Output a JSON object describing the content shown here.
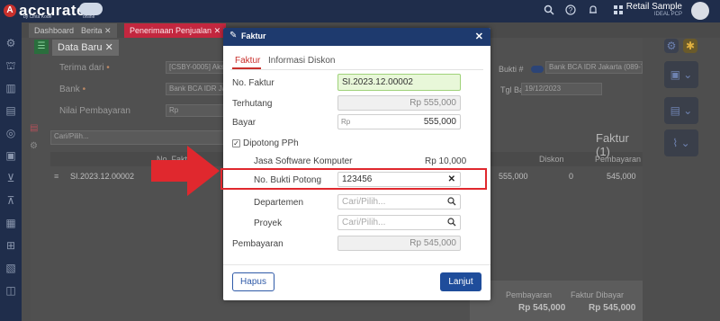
{
  "topbar": {
    "logo_text": "accurate",
    "logo_sub": "by Cinta Kode",
    "cloud_sub": "online",
    "user_name": "Retail Sample",
    "user_sub": "IDEAL PCP",
    "icons": [
      "search-icon",
      "help-icon",
      "bell-icon",
      "grid-icon"
    ]
  },
  "tabs": [
    {
      "label": "Dashboard",
      "active": false
    },
    {
      "label": "Berita",
      "active": false
    },
    {
      "label": "Penerimaan Penjualan",
      "active": true
    }
  ],
  "subtab": {
    "label": "Data Baru"
  },
  "form": {
    "terima_dari_label": "Terima dari",
    "terima_dari_value": "[CSBY-0005] Aks...",
    "bank_label": "Bank",
    "bank_value": "Bank BCA IDR Jak...",
    "nilai_label": "Nilai Pembayaran",
    "nilai_prefix": "Rp",
    "cari_placeholder": "Cari/Pilih...",
    "no_faktur_col": "No. Faktur",
    "row_faktur": "SI.2023.12.00002",
    "bukti_label": "Bukti #",
    "bank_right_value": "Bank BCA IDR Jakarta (089-773-...",
    "tgl_label": "Tgl Bayar",
    "tgl_value": "19/12/2023",
    "faktur_heading": "Faktur (1)",
    "col_diskon": "Diskon",
    "col_pembayaran": "Pembayaran",
    "row_terhutang": "555,000",
    "row_diskon": "0",
    "row_pembayaran": "545,000",
    "sum_pembayaran_label": "Pembayaran",
    "sum_pembayaran_value": "Rp 545,000",
    "sum_faktur_label": "Faktur Dibayar",
    "sum_faktur_value": "Rp 545,000"
  },
  "dialog": {
    "title": "Faktur",
    "tab_faktur": "Faktur",
    "tab_diskon": "Informasi Diskon",
    "no_faktur_label": "No. Faktur",
    "no_faktur_value": "SI.2023.12.00002",
    "terhutang_label": "Terhutang",
    "terhutang_value": "Rp 555,000",
    "bayar_label": "Bayar",
    "bayar_prefix": "Rp",
    "bayar_value": "555,000",
    "pph_label": "Dipotong PPh",
    "pph_checked": true,
    "jasa_label": "Jasa Software Komputer",
    "jasa_value": "Rp 10,000",
    "bukti_label": "No. Bukti Potong",
    "bukti_value": "123456",
    "departemen_label": "Departemen",
    "departemen_placeholder": "Cari/Pilih...",
    "proyek_label": "Proyek",
    "proyek_placeholder": "Cari/Pilih...",
    "pembayaran_label": "Pembayaran",
    "pembayaran_value": "Rp 545,000",
    "hapus_label": "Hapus",
    "lanjut_label": "Lanjut"
  },
  "colors": {
    "brand_navy": "#1f2d4b",
    "accent_red": "#c9302c",
    "dialog_header": "#1e3a6e",
    "highlight": "#e0282e",
    "primary_button": "#1f4d9b"
  }
}
